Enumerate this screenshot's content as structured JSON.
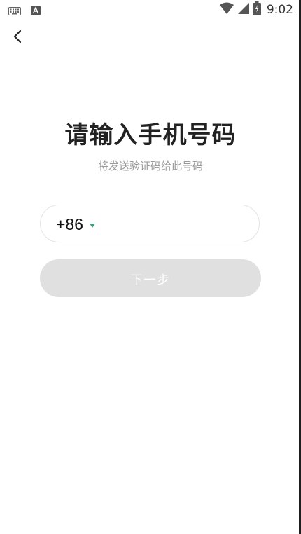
{
  "status_bar": {
    "time": "9:02",
    "icons": [
      "keyboard-icon",
      "a-box-icon",
      "wifi-icon",
      "signal-icon",
      "battery-icon"
    ]
  },
  "header": {
    "back_icon": "chevron-left-icon"
  },
  "main": {
    "title": "请输入手机号码",
    "subtitle": "将发送验证码给此号码",
    "phone": {
      "country_code": "+86",
      "value": "",
      "placeholder": ""
    },
    "next_button_label": "下一步"
  },
  "colors": {
    "accent": "#3f9c78",
    "button_disabled_bg": "#e0e0e0",
    "title_text": "#222222",
    "subtitle_text": "#9a9a9a"
  }
}
